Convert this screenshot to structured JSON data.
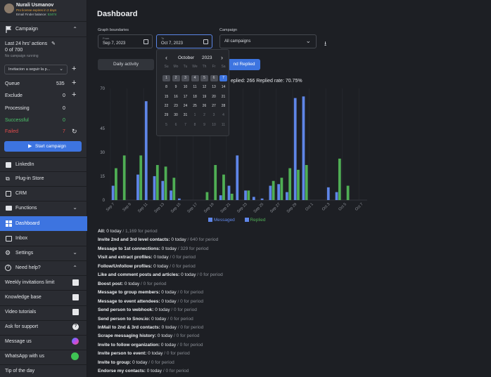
{
  "user": {
    "name": "Nurali Usmanov",
    "license": "Pro license expires in 2 days",
    "finder_label": "Email Finder balance:",
    "finder_value": "53474"
  },
  "campaign": {
    "header": "Campaign",
    "last24_label": "Last 24 hrs' actions",
    "count": "0 of 700",
    "no_running": "No campaign running",
    "selected": "Invitacion a seguir la p...",
    "rows": [
      {
        "label": "Queue",
        "value": "535",
        "color": "#e4e6ea"
      },
      {
        "label": "Exclude",
        "value": "0",
        "color": "#e4e6ea"
      },
      {
        "label": "Processing",
        "value": "0",
        "color": "#e4e6ea"
      },
      {
        "label": "Successful",
        "value": "0",
        "color": "#4cc46a"
      },
      {
        "label": "Failed",
        "value": "7",
        "color": "#e04b4b"
      }
    ],
    "start": "Start campaign"
  },
  "nav": {
    "linkedin": "LinkedIn",
    "plugin": "Plug-in Store",
    "crm": "CRM",
    "functions": "Functions",
    "dashboard": "Dashboard",
    "inbox": "Inbox",
    "settings": "Settings",
    "help": "Need help?",
    "links": [
      "Weekly invitations limit",
      "Knowledge base",
      "Video tutorials",
      "Ask for support",
      "Message us",
      "WhatsApp with us",
      "Tip of the day"
    ]
  },
  "main": {
    "title": "Dashboard",
    "graph_label": "Graph boundaries",
    "from_label": "From",
    "from": "Sep 7, 2023",
    "to_label": "To",
    "to": "Oct 7, 2023",
    "campaign_label": "Campaign",
    "campaign_value": "All campaigns",
    "tab_daily": "Daily activity",
    "tab_active": "nd Replied",
    "summary": "eplied: 266  Replied rate: 70.75%"
  },
  "calendar": {
    "month": "October",
    "year": "2023",
    "weekdays": [
      "Su",
      "Mo",
      "Tu",
      "We",
      "Th",
      "Fr",
      "Sa"
    ],
    "days": [
      [
        "1",
        "2",
        "3",
        "4",
        "5",
        "6",
        "7"
      ],
      [
        "8",
        "9",
        "10",
        "11",
        "12",
        "13",
        "14"
      ],
      [
        "15",
        "16",
        "17",
        "18",
        "19",
        "20",
        "21"
      ],
      [
        "22",
        "23",
        "24",
        "25",
        "26",
        "27",
        "28"
      ],
      [
        "29",
        "30",
        "31",
        "1",
        "2",
        "3",
        "4"
      ],
      [
        "5",
        "6",
        "7",
        "8",
        "9",
        "10",
        "11"
      ]
    ]
  },
  "chart_data": {
    "type": "bar",
    "yticks": [
      0,
      15,
      30,
      45,
      70
    ],
    "ylim": [
      0,
      70
    ],
    "xticks": [
      "Sep 7",
      "Sep 9",
      "Sep 11",
      "Sep 13",
      "Sep 15",
      "Sep 17",
      "Sep 19",
      "Sep 21",
      "Sep 23",
      "Sep 25",
      "Sep 27",
      "Sep 29",
      "Oct 1",
      "Oct 3",
      "Oct 5",
      "Oct 7"
    ],
    "series": [
      {
        "name": "Messaged",
        "color": "#5f86e8",
        "values": [
          9,
          0,
          0,
          16,
          62,
          15,
          12,
          6,
          1,
          0,
          0,
          0,
          0,
          3,
          9,
          28,
          6,
          2,
          1,
          9,
          10,
          5,
          64,
          65,
          0,
          0,
          8,
          5,
          0,
          0,
          0
        ]
      },
      {
        "name": "Replied",
        "color": "#4fae54",
        "values": [
          20,
          28,
          0,
          28,
          0,
          22,
          21,
          14,
          0,
          0,
          0,
          5,
          22,
          16,
          4,
          0,
          6,
          0,
          0,
          12,
          14,
          20,
          19,
          22,
          0,
          0,
          0,
          26,
          9,
          0,
          0
        ]
      }
    ],
    "legend": [
      "Messaged",
      "Replied"
    ]
  },
  "stats": [
    {
      "label": "All:",
      "today": "0 today",
      "period": "1,169 for period"
    },
    {
      "label": "Invite 2nd and 3rd level contacts:",
      "today": "0 today",
      "period": "640 for period"
    },
    {
      "label": "Message to 1st connections:",
      "today": "0 today",
      "period": "329 for period"
    },
    {
      "label": "Visit and extract profiles:",
      "today": "0 today",
      "period": "0 for period"
    },
    {
      "label": "Follow/Unfollow profiles:",
      "today": "0 today",
      "period": "0 for period"
    },
    {
      "label": "Like and comment posts and articles:",
      "today": "0 today",
      "period": "0 for period"
    },
    {
      "label": "Boost post:",
      "today": "0 today",
      "period": "0 for period"
    },
    {
      "label": "Message to group members:",
      "today": "0 today",
      "period": "0 for period"
    },
    {
      "label": "Message to event attendees:",
      "today": "0 today",
      "period": "0 for period"
    },
    {
      "label": "Send person to webhook:",
      "today": "0 today",
      "period": "0 for period"
    },
    {
      "label": "Send person to Snov.io:",
      "today": "0 today",
      "period": "0 for period"
    },
    {
      "label": "InMail to 2nd & 3rd contacts:",
      "today": "0 today",
      "period": "0 for period"
    },
    {
      "label": "Scrape messaging history:",
      "today": "0 today",
      "period": "0 for period"
    },
    {
      "label": "Invite to follow organization:",
      "today": "0 today",
      "period": "0 for period"
    },
    {
      "label": "Invite person to event:",
      "today": "0 today",
      "period": "0 for period"
    },
    {
      "label": "Invite to group:",
      "today": "0 today",
      "period": "0 for period"
    },
    {
      "label": "Endorse my contacts:",
      "today": "0 today",
      "period": "0 for period"
    }
  ]
}
